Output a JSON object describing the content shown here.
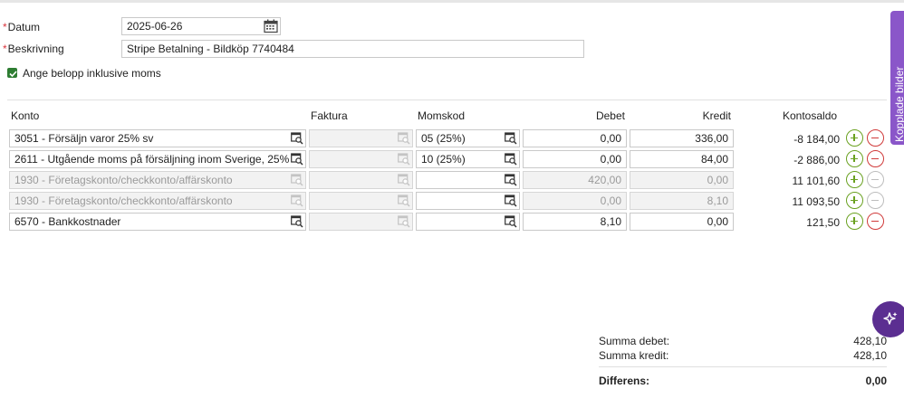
{
  "form": {
    "datum_label": "Datum",
    "datum_value": "2025-06-26",
    "beskrivning_label": "Beskrivning",
    "beskrivning_value": "Stripe Betalning - Bildköp 7740484",
    "inkl_moms_label": "Ange belopp inklusive moms",
    "inkl_moms_checked": true
  },
  "table": {
    "headers": {
      "konto": "Konto",
      "faktura": "Faktura",
      "momskod": "Momskod",
      "debet": "Debet",
      "kredit": "Kredit",
      "kontosaldo": "Kontosaldo"
    },
    "rows": [
      {
        "konto": "3051 - Försäljn varor 25% sv",
        "faktura": "",
        "momskod": "05 (25%)",
        "debet": "0,00",
        "kredit": "336,00",
        "saldo": "-8 184,00",
        "editable": true
      },
      {
        "konto": "2611 - Utgående moms på försäljning inom Sverige, 25%",
        "faktura": "",
        "momskod": "10 (25%)",
        "debet": "0,00",
        "kredit": "84,00",
        "saldo": "-2 886,00",
        "editable": true
      },
      {
        "konto": "1930 - Företagskonto/checkkonto/affärskonto",
        "faktura": "",
        "momskod": "",
        "debet": "420,00",
        "kredit": "0,00",
        "saldo": "11 101,60",
        "editable": false
      },
      {
        "konto": "1930 - Företagskonto/checkkonto/affärskonto",
        "faktura": "",
        "momskod": "",
        "debet": "0,00",
        "kredit": "8,10",
        "saldo": "11 093,50",
        "editable": false
      },
      {
        "konto": "6570 - Bankkostnader",
        "faktura": "",
        "momskod": "",
        "debet": "8,10",
        "kredit": "0,00",
        "saldo": "121,50",
        "editable": true
      }
    ]
  },
  "summary": {
    "summa_debet_label": "Summa debet:",
    "summa_debet_value": "428,10",
    "summa_kredit_label": "Summa kredit:",
    "summa_kredit_value": "428,10",
    "differens_label": "Differens:",
    "differens_value": "0,00"
  },
  "side_tab": {
    "label": "Kopplade bilder"
  },
  "colors": {
    "accent_purple": "#8a56c9",
    "fab_purple": "#5b2e91",
    "plus_green": "#6aa120",
    "minus_red": "#d03a3a",
    "checkbox_green": "#2e7d32"
  },
  "icons": {
    "calendar": "calendar-icon",
    "lookup": "account-lookup-icon",
    "plus": "plus-icon",
    "minus": "minus-icon",
    "sparkle": "sparkle-icon"
  }
}
